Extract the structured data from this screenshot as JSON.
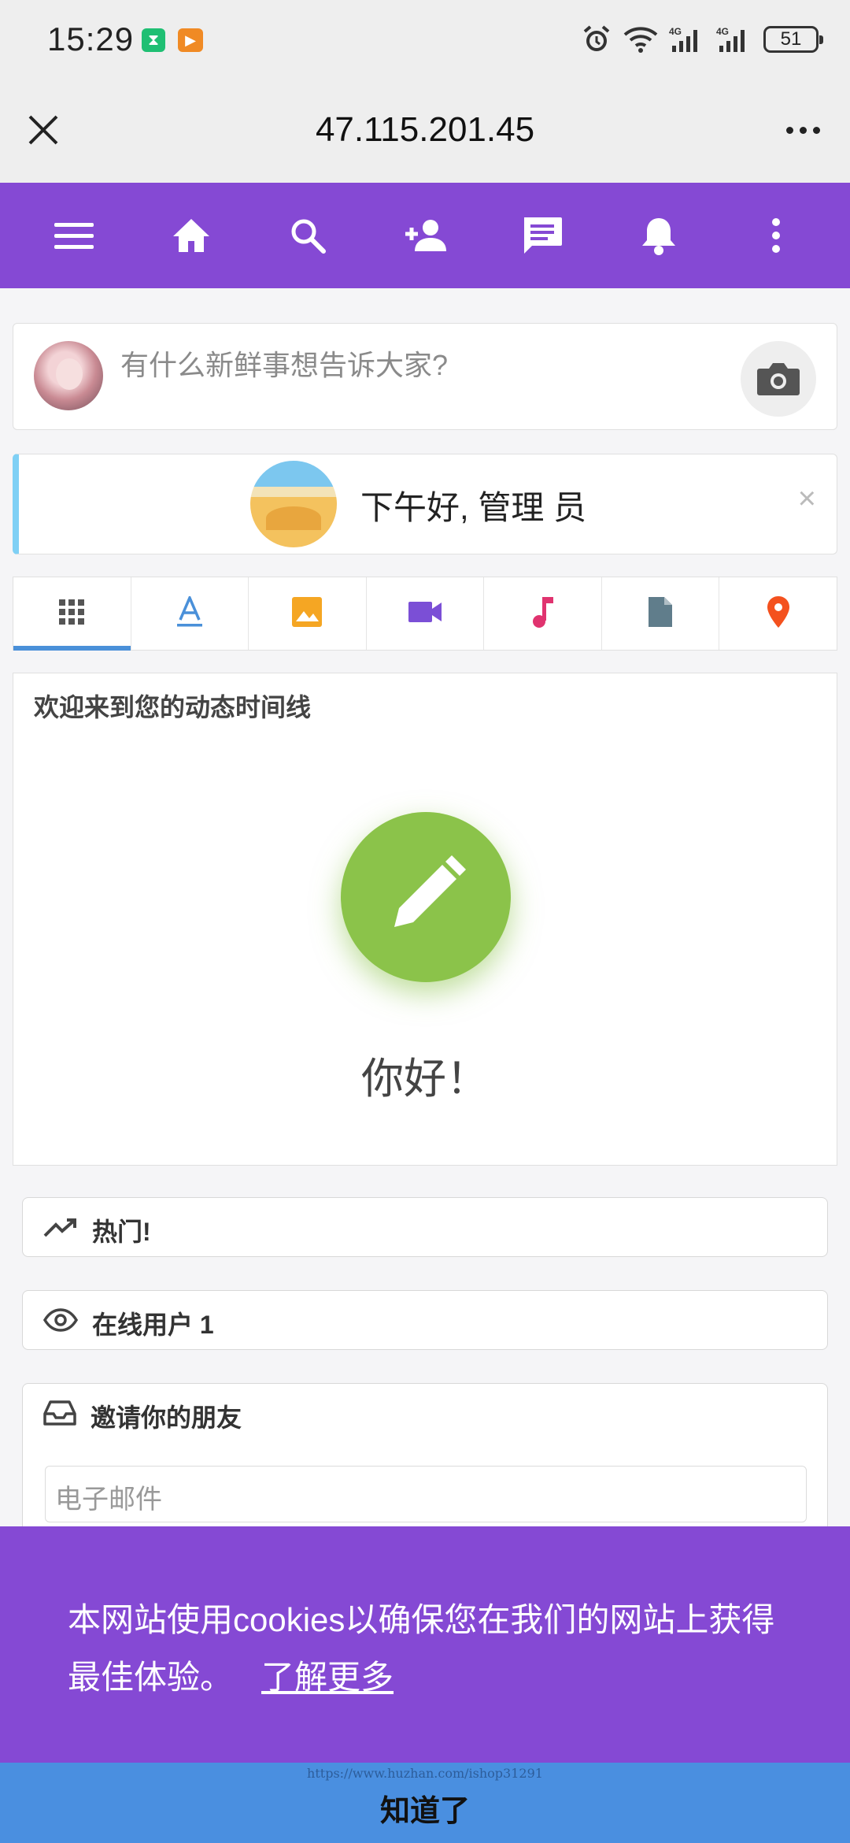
{
  "status_bar": {
    "time": "15:29",
    "app_icon_1": "hourglass-icon",
    "app_icon_2": "play-icon",
    "battery": "51",
    "icons": [
      "alarm-icon",
      "wifi-icon",
      "signal-4g-icon",
      "signal-4g-icon",
      "battery-icon"
    ]
  },
  "browser": {
    "title": "47.115.201.45",
    "close_icon": "close-icon",
    "menu_icon": "more-horizontal-icon"
  },
  "nav": {
    "background": "#8549d4",
    "icons": [
      "menu-icon",
      "home-icon",
      "search-icon",
      "add-user-icon",
      "messages-icon",
      "notifications-icon",
      "more-vertical-icon"
    ]
  },
  "composer": {
    "placeholder": "有什么新鲜事想告诉大家?",
    "camera_icon": "camera-icon"
  },
  "greeting": {
    "text": "下午好, 管理 员",
    "close": "×"
  },
  "post_tabs": {
    "icons": [
      "grid-icon",
      "text-icon",
      "image-icon",
      "video-icon",
      "music-icon",
      "file-icon",
      "location-icon"
    ],
    "colors": [
      "#555555",
      "#4a90d9",
      "#f5a623",
      "#7b4fd6",
      "#e0336f",
      "#607d8b",
      "#f4511e"
    ],
    "active_index": 0
  },
  "timeline": {
    "title": "欢迎来到您的动态时间线",
    "hello": "你好！",
    "accent": "#8bc34a"
  },
  "widgets": {
    "trending": "热门!",
    "online_users": "在线用户 1",
    "invite_title": "邀请你的朋友",
    "email_placeholder": "电子邮件"
  },
  "cookie": {
    "message": "本网站使用cookies以确保您在我们的网站上获得最佳体验。",
    "learn_more": "了解更多",
    "accept": "知道了",
    "watermark": "https://www.huzhan.com/ishop31291"
  }
}
